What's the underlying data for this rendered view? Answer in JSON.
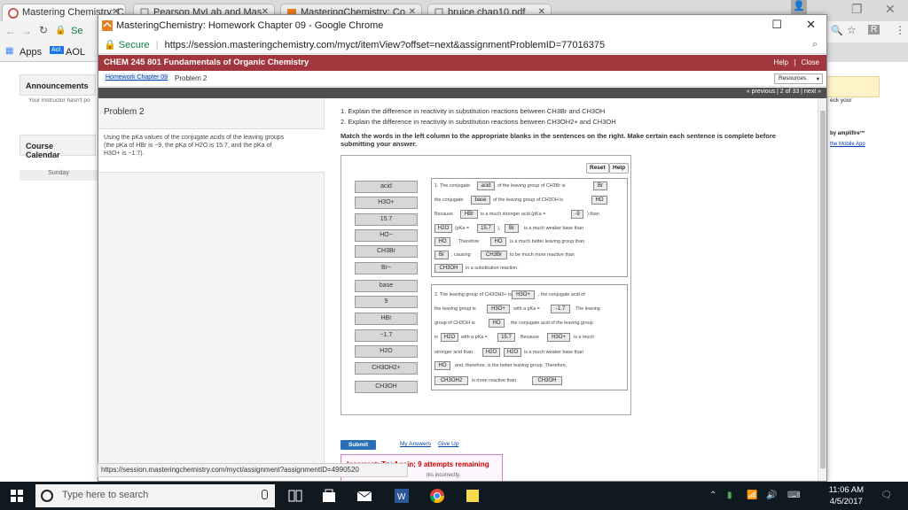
{
  "back_browser": {
    "tabs": [
      {
        "label": "Mastering Chemistry: C"
      },
      {
        "label": "Pearson MyLab and Mas"
      },
      {
        "label": "MasteringChemistry: Co"
      },
      {
        "label": "bruice chap10.pdf"
      }
    ],
    "url_partial": "Se",
    "bookmarks": [
      "Apps",
      "AOL"
    ],
    "announcements": "Announcements",
    "instructor_note": "Your instructor hasn't po",
    "course_calendar": "Course Calendar",
    "sunday": "Sunday",
    "right_text_1": "eck your",
    "right_text_2": "by amplifire™",
    "right_text_3": "the Mobile App"
  },
  "popup": {
    "title": "MasteringChemistry: Homework Chapter 09 - Google Chrome",
    "secure_label": "Secure",
    "url": "https://session.masteringchemistry.com/myct/itemView?offset=next&assignmentProblemID=77016375",
    "course_title": "CHEM 245 801 Fundamentals of Organic Chemistry",
    "help_link": "Help",
    "close_link": "Close",
    "breadcrumb_link": "Homework Chapter 09",
    "breadcrumb_current": "Problem 2",
    "resources": "Resources",
    "pager": "« previous | 2 of 33 | next »"
  },
  "problem": {
    "title": "Problem 2",
    "note_1": "Using the pKa values of the conjugate acids of the leaving groups",
    "note_2": "(the pKa of HBr is −9, the pKa of H2O is 15.7, and the pKa of",
    "note_3": "H3O+ is −1.7).",
    "q1": "1. Explain the difference in reactivity in substitution reactions between CH3Br and CH3OH",
    "q2": "2. Explain the difference in reactivity in substitution reactions between CH3OH2+ and CH3OH",
    "instructions": "Match the words in the left column to the appropriate blanks in the sentences on the right. Make certain each sentence is complete before submitting your answer.",
    "reset": "Reset",
    "help": "Help"
  },
  "chips": [
    "acid",
    "H3O+",
    "15.7",
    "HO−",
    "CH3Br",
    "Br−",
    "base",
    "9",
    "HBr",
    "−1.7",
    "H2O",
    "CH3OH2+",
    "CH3OH"
  ],
  "sentence1": {
    "t1": "1. The conjugate",
    "b_acid": "acid",
    "t2": "of the leaving group of CH3Br is",
    "b_br": "Br",
    "t3": "the conjugate",
    "b_base": "base",
    "t4": "of the leaving group of CH3OH is",
    "b_ho": "HO",
    "t5": "Because",
    "b_hbr": "HBr",
    "t6": "is a much stronger acid (pKa =",
    "b_9": "-9",
    "t7": ") than",
    "b_h2o": "H2O",
    "t8": "(pKa =",
    "b_157": "15.7",
    "t9": "),",
    "b_br2": "Br",
    "t10": "is a much weaker base than",
    "b_ho2": "HO",
    "t11": "Therefore",
    "b_ho3": "HO",
    "t12": "is a much better leaving group than",
    "b_br3": "Br",
    "t13": ", causing",
    "b_ch3br": "CH3Br",
    "t14": "to be much more reactive than",
    "b_ch3oh": "CH3OH",
    "t15": "in a substitution reaction."
  },
  "sentence2": {
    "t1": "2. The leaving group of CH3OH2+ is",
    "b_h3o": "H3O+",
    "t2": ", the conjugate acid of",
    "t3": "the leaving group is",
    "b_h3o2": "H3O+",
    "t4": "with a pKa =",
    "b_m17": "-1.7",
    "t5": ". The leaving",
    "t6": "group of CH3OH is",
    "b_ho": "HO",
    "t7": ", the conjugate acid of the leaving group",
    "t8": "is",
    "b_h2o": "H2O",
    "t9": "with a pKa =",
    "b_157": "15.7",
    "t10": ". Because",
    "b_h3o3": "H3O+",
    "t11": "is a much",
    "t12": "stronger acid than",
    "b_h2o2": "H2O",
    "b_h2o3": "H2O",
    "t13": "is a much weaker base than",
    "b_ho2": "HO",
    "t14": "and, therefore, is the better leaving group. Therefore,",
    "b_ch3oh2": "CH3OH2",
    "t15": "is more reactive than",
    "b_ch3oh": "CH3OH"
  },
  "actions": {
    "submit": "Submit",
    "my_answers": "My Answers",
    "give_up": "Give Up"
  },
  "feedback": {
    "title": "Incorrect; Try Again; 9 attempts remaining",
    "sub": "rks incorrectly."
  },
  "status_url": "https://session.masteringchemistry.com/myct/assignment?assignmentID=4990520",
  "taskbar": {
    "search_placeholder": "Type here to search",
    "time": "11:06 AM",
    "date": "4/5/2017"
  },
  "colors": {
    "course_bar": "#a1373c",
    "submit": "#2b6fb6",
    "feedback_border": "#d57cd2",
    "feedback_text": "#cc0000"
  }
}
